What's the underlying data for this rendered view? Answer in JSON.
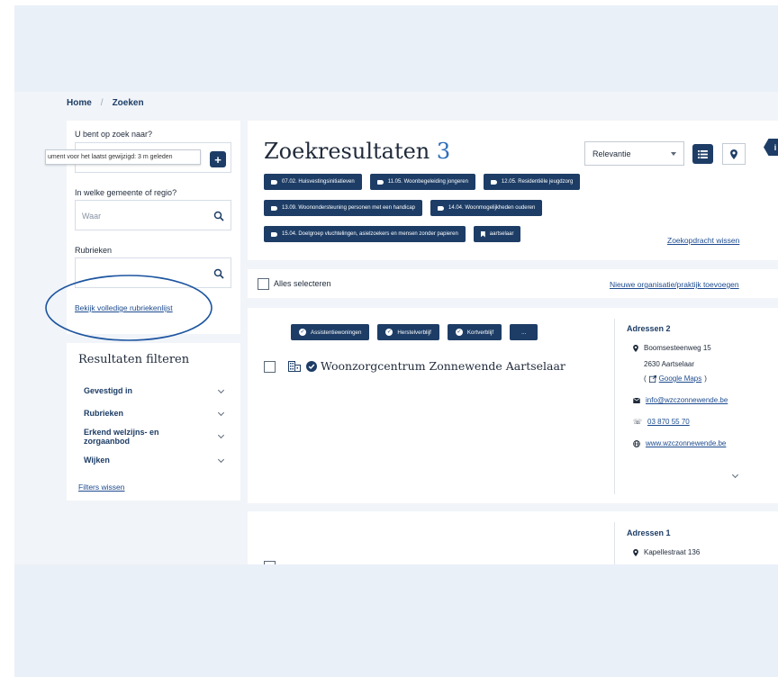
{
  "breadcrumb": {
    "home": "Home",
    "separator": "/",
    "current": "Zoeken"
  },
  "search": {
    "what_label": "U bent op zoek naar?",
    "tooltip": "ument voor het laatst gewijzigd: 3 m geleden",
    "add_button": "+",
    "where_label": "In welke gemeente of regio?",
    "where_placeholder": "Waar",
    "rubrieken_label": "Rubrieken",
    "rubrieken_link": "Bekijk volledige rubriekenlijst"
  },
  "filters": {
    "title": "Resultaten filteren",
    "items": [
      {
        "line1": "Gevestigd in",
        "line2": ""
      },
      {
        "line1": "Rubrieken",
        "line2": ""
      },
      {
        "line1": "Erkend welzijns- en",
        "line2": "zorgaanbod"
      },
      {
        "line1": "Wijken",
        "line2": ""
      }
    ],
    "clear": "Filters wissen"
  },
  "results": {
    "title": "Zoekresultaten",
    "count": "3",
    "sort_value": "Relevantie",
    "info_icon": "i",
    "tags_row1": [
      "07.02. Huisvestingsinitiatieven",
      "11.05. Woonbegeleiding jongeren",
      "12.05. Residentiële jeugdzorg"
    ],
    "tags_row2": [
      "13.09. Woonondersteuning personen met een handicap",
      "14.04. Woonmogelijkheden ouderen"
    ],
    "tags_row3": [
      "15.04. Doelgroep vluchtelingen, asielzoekers en mensen zonder papieren"
    ],
    "location_tag": "aartselaar",
    "clear_search": "Zoekopdracht wissen",
    "select_all": "Alles selecteren",
    "new_org": "Nieuwe organisatie/praktijk toevoegen"
  },
  "result1": {
    "categories": [
      "Assistentiewoningen",
      "Herstelverblijf",
      "Kortverblijf"
    ],
    "more": "...",
    "name": "Woonzorgcentrum Zonnewende Aartselaar",
    "addresses_title": "Adressen 2",
    "street": "Boomsesteenweg 15",
    "city": "2630 Aartselaar",
    "maps_open": "(",
    "maps_link": "Google Maps",
    "maps_close": ")",
    "email": "info@wzczonnewende.be",
    "phone": "03 870 55 70",
    "website": "www.wzczonnewende.be"
  },
  "result2": {
    "addresses_title": "Adressen 1",
    "street": "Kapellestraat 136"
  },
  "colors": {
    "navy": "#1d3d66",
    "page_bg": "#f1f4f8",
    "frame_bg": "#e9f0f8",
    "annotation": "#1d55a0"
  }
}
